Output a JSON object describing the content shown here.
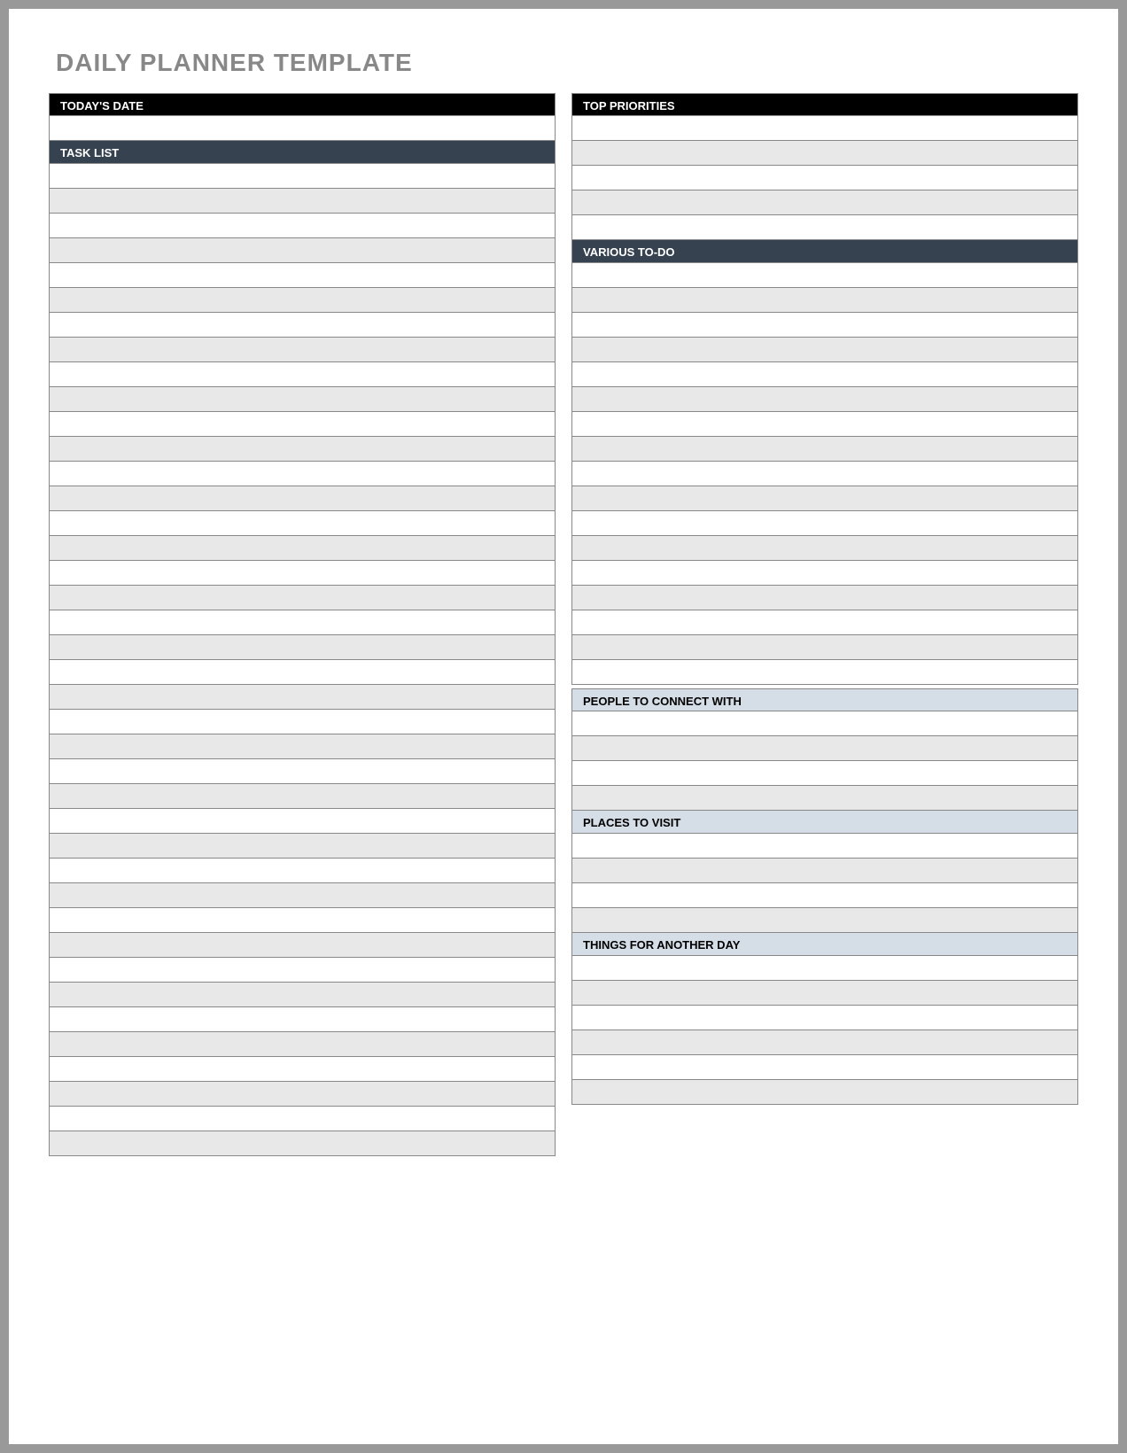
{
  "title": "DAILY PLANNER TEMPLATE",
  "left": {
    "todays_date": "TODAY'S DATE",
    "task_list": "TASK LIST"
  },
  "right": {
    "top_priorities": "TOP PRIORITIES",
    "various_todo": "VARIOUS TO-DO",
    "people_connect": "PEOPLE TO CONNECT WITH",
    "places_visit": "PLACES TO VISIT",
    "things_another": "THINGS FOR ANOTHER DAY"
  }
}
